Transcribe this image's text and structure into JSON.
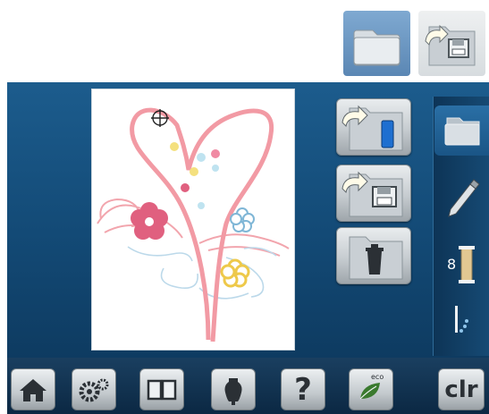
{
  "legend": {
    "folder_icon": "folder-icon",
    "save_icon": "save-to-folder-icon"
  },
  "screen": {
    "side_buttons": [
      "load-from-device-icon",
      "save-to-folder-icon",
      "delete-folder-icon"
    ],
    "tabs": [
      "folder-icon",
      "pencil-icon",
      "thread-spool-icon",
      "needle-stitch-icon"
    ],
    "thread_number": "8"
  },
  "toolbar": {
    "help_label": "?",
    "eco_label": "eco",
    "clr_label": "clr"
  },
  "colors": {
    "screen_blue": "#1c5c8d",
    "heart_pink": "#f0a0a8",
    "flower_red": "#e0607f"
  }
}
